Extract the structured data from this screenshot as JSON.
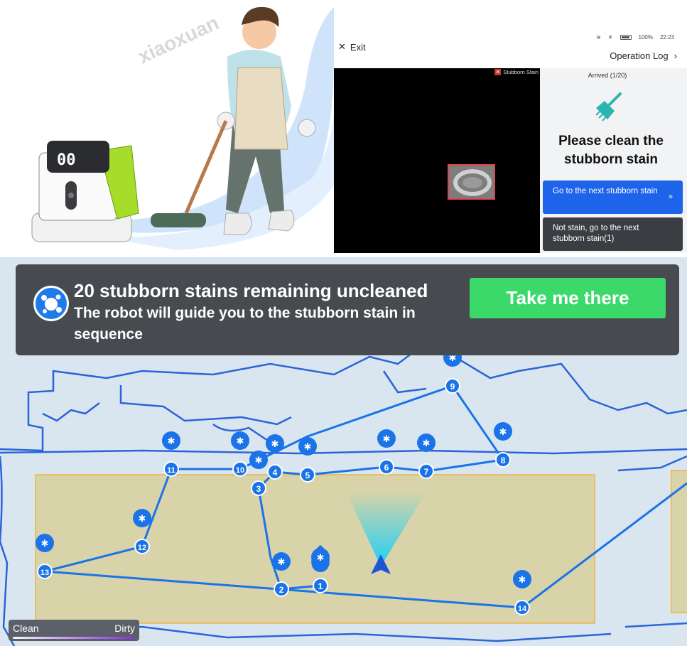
{
  "tablet": {
    "status": {
      "battery": "100%",
      "time": "22:23"
    },
    "exit_label": "Exit",
    "operation_log_label": "Operation Log",
    "camera_tag": "Stubborn Stain",
    "arrived": "Arrived (1/20)",
    "prompt_line1": "Please clean the",
    "prompt_line2": "stubborn stain",
    "next_button": "Go to the next stubborn stain",
    "not_stain_button": "Not stain, go to the next stubborn stain(1)"
  },
  "map": {
    "banner": {
      "title": "20 stubborn stains remaining uncleaned",
      "subtitle": "The robot will guide you to the stubborn stain in sequence",
      "button": "Take me there"
    },
    "legend": {
      "clean": "Clean",
      "dirty": "Dirty"
    },
    "markers": [
      "1",
      "2",
      "3",
      "4",
      "5",
      "6",
      "7",
      "8",
      "9",
      "10",
      "11",
      "12",
      "13",
      "14"
    ]
  },
  "watermark": "xiaoxuan",
  "colors": {
    "accent_blue": "#1e64ea",
    "marker_blue": "#1a73e8",
    "take_me_green": "#3bd86a",
    "zone_fill": "#d8d3a8",
    "zone_border": "#f0b341"
  }
}
